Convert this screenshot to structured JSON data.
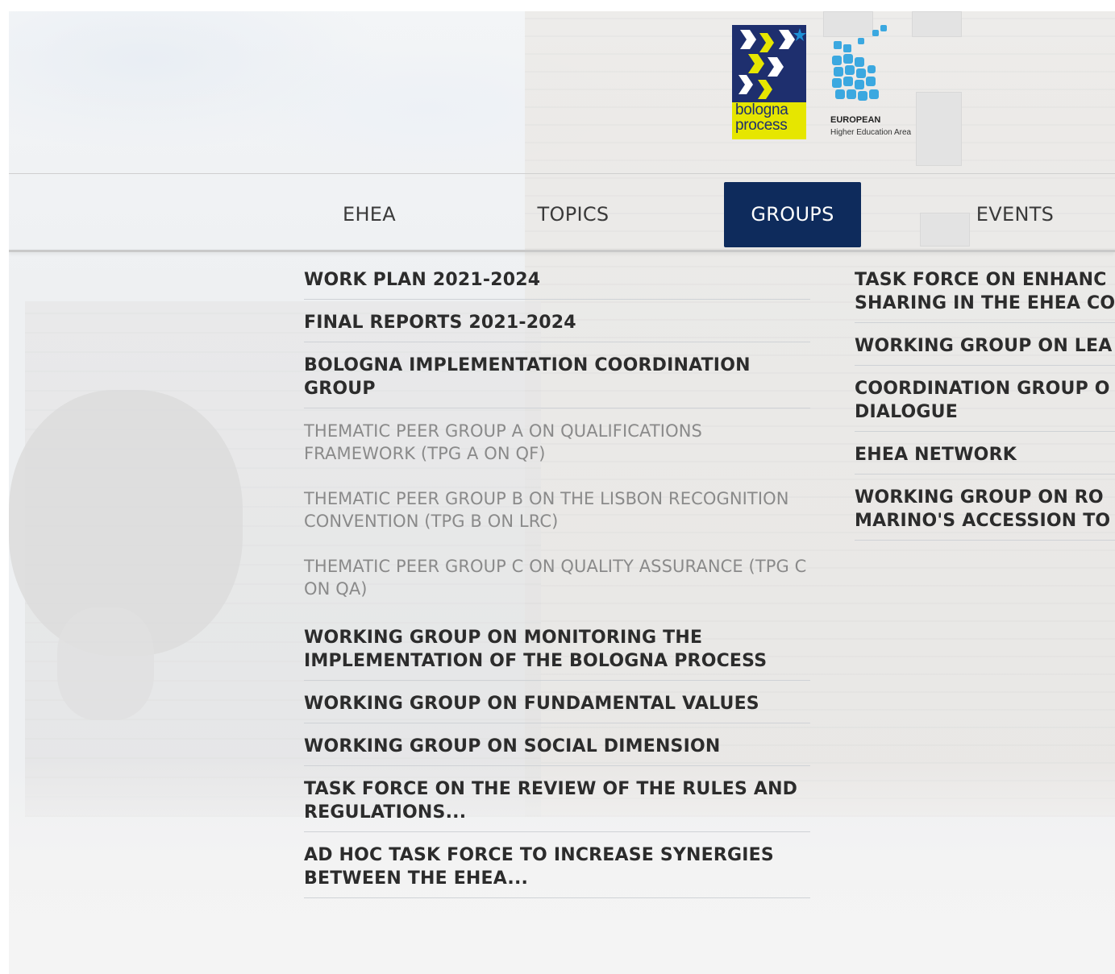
{
  "logos": {
    "bologna_line1": "bologna",
    "bologna_line2": "process",
    "ehea_line1": "EUROPEAN",
    "ehea_line2": "Higher Education Area"
  },
  "nav": {
    "items": [
      {
        "label": "EHEA"
      },
      {
        "label": "TOPICS"
      },
      {
        "label": "GROUPS",
        "active": true
      },
      {
        "label": "EVENTS"
      }
    ]
  },
  "menu": {
    "left": [
      {
        "label": "WORK PLAN 2021-2024"
      },
      {
        "label": "FINAL REPORTS 2021-2024"
      },
      {
        "label": "BOLOGNA IMPLEMENTATION COORDINATION GROUP"
      },
      {
        "label": "THEMATIC PEER GROUP A ON QUALIFICATIONS FRAMEWORK (TPG A ON QF)"
      },
      {
        "label": "THEMATIC PEER GROUP B ON THE LISBON RECOGNITION CONVENTION (TPG B ON LRC)"
      },
      {
        "label": "THEMATIC PEER GROUP C ON QUALITY ASSURANCE (TPG C ON QA)"
      },
      {
        "label": "WORKING GROUP ON MONITORING THE IMPLEMENTATION OF THE BOLOGNA PROCESS"
      },
      {
        "label": "WORKING GROUP ON FUNDAMENTAL VALUES"
      },
      {
        "label": "WORKING GROUP ON SOCIAL DIMENSION"
      },
      {
        "label": "TASK FORCE ON THE REVIEW OF THE RULES AND REGULATIONS..."
      },
      {
        "label": "AD HOC TASK FORCE TO INCREASE SYNERGIES BETWEEN THE EHEA..."
      }
    ],
    "right": [
      {
        "line1": "TASK FORCE ON ENHANC",
        "line2": "SHARING IN THE EHEA CO"
      },
      {
        "line1": "WORKING GROUP ON LEA",
        "line2": ""
      },
      {
        "line1": "COORDINATION GROUP O",
        "line2": "DIALOGUE"
      },
      {
        "line1": "EHEA NETWORK",
        "line2": ""
      },
      {
        "line1": "WORKING GROUP ON RO",
        "line2": "MARINO'S ACCESSION TO"
      }
    ]
  },
  "colors": {
    "nav_active_bg": "#0e2b5c",
    "bologna_blue": "#1e2f6e",
    "bologna_yellow": "#e6e600",
    "ehea_blue": "#3ba8e0"
  }
}
